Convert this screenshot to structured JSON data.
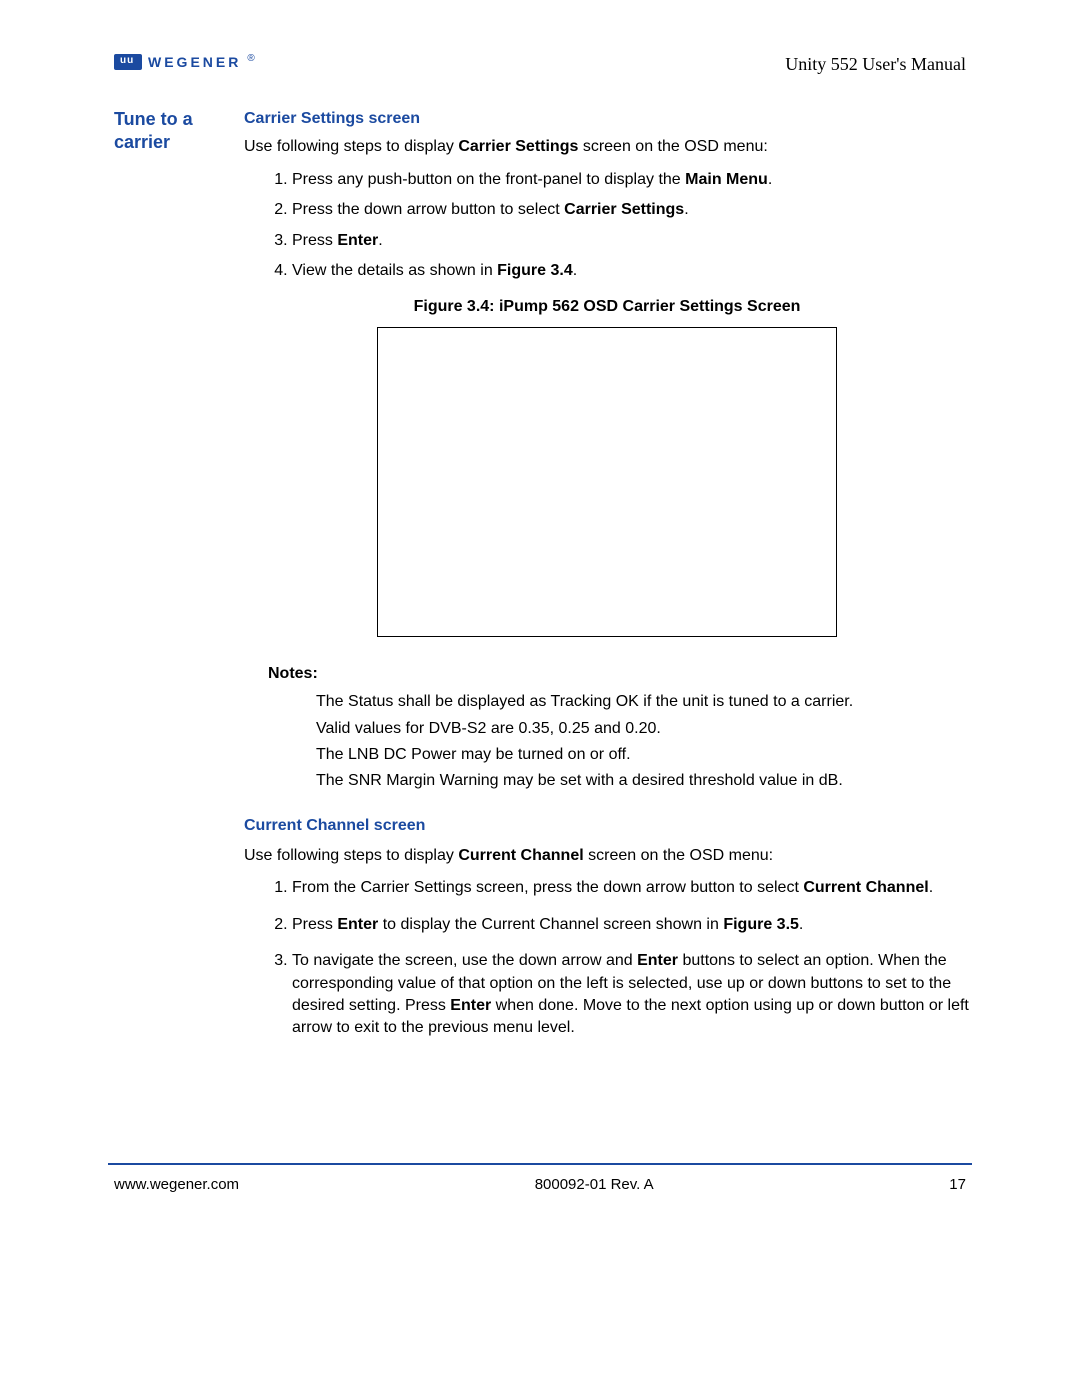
{
  "header": {
    "brand_text": "WEGENER",
    "doc_title": "Unity 552 User's Manual"
  },
  "side_heading": "Tune to a carrier",
  "section1": {
    "heading": "Carrier Settings screen",
    "intro_pre": "Use following steps to display ",
    "intro_bold": "Carrier Settings",
    "intro_post": " screen on the OSD menu:",
    "step1_pre": "Press any push-button on the front-panel to display the ",
    "step1_bold": "Main Menu",
    "step1_post": ".",
    "step2_pre": "Press the down arrow button to select ",
    "step2_bold": "Carrier Settings",
    "step2_post": ".",
    "step3_pre": "Press ",
    "step3_bold": "Enter",
    "step3_post": ".",
    "step4_pre": "View the details as shown in ",
    "step4_bold": "Figure 3.4",
    "step4_post": ".",
    "figure_caption": "Figure 3.4:   iPump 562 OSD Carrier Settings Screen",
    "notes_label": "Notes:",
    "note1": "The Status shall be displayed as Tracking OK if the unit is tuned to a carrier.",
    "note2": "Valid values for DVB-S2 are 0.35, 0.25 and 0.20.",
    "note3": "The LNB DC Power may be turned on or off.",
    "note4": "The SNR Margin Warning may be set with a desired threshold value in dB."
  },
  "section2": {
    "heading": "Current Channel screen",
    "intro_pre": "Use following steps to display ",
    "intro_bold": "Current Channel",
    "intro_post": " screen on the OSD menu:",
    "step1_pre": "From the Carrier Settings screen, press the down arrow button to select ",
    "step1_bold": "Current Channel",
    "step1_post": ".",
    "step2_pre": "Press ",
    "step2_bold": "Enter",
    "step2_mid": " to display the Current Channel screen shown in ",
    "step2_bold2": "Figure 3.5",
    "step2_post": ".",
    "step3_pre": "To navigate the screen, use the down arrow and ",
    "step3_bold": "Enter",
    "step3_mid": " buttons to select an option. When the corresponding value of that option on the left is selected, use up or down buttons to set to the desired setting. Press ",
    "step3_bold2": "Enter",
    "step3_post": " when done. Move to the next option using up or down button or left arrow to exit to the previous menu level."
  },
  "footer": {
    "left": "www.wegener.com",
    "center": "800092-01 Rev. A",
    "right": "17"
  }
}
